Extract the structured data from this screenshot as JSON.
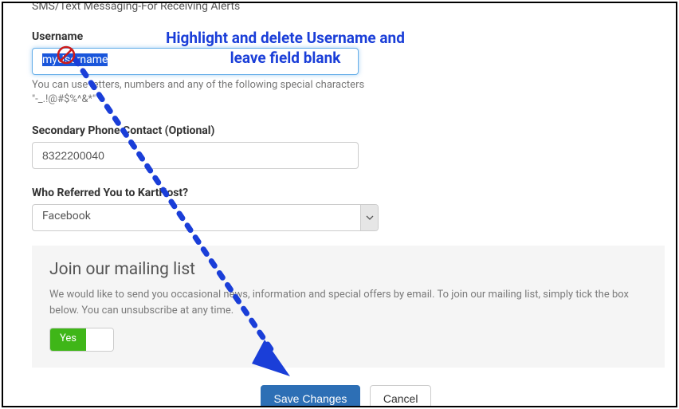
{
  "sections": {
    "sms_label": "SMS/Text Messaging-For Receiving Alerts"
  },
  "username": {
    "label": "Username",
    "value": "myUsername",
    "hint": "You can use letters, numbers and any of the following special characters \"-_.!@#$%^&*\""
  },
  "secondary_phone": {
    "label": "Secondary Phone Contact (Optional)",
    "value": "8322200040"
  },
  "referral": {
    "label": "Who Referred You to KartHost?",
    "value": "Facebook"
  },
  "mailing": {
    "heading": "Join our mailing list",
    "body": "We would like to send you occasional news, information and special offers by email. To join our mailing list, simply tick the box below. You can unsubscribe at any time.",
    "toggle_yes": "Yes"
  },
  "buttons": {
    "save": "Save Changes",
    "cancel": "Cancel"
  },
  "annotation": {
    "line1": "Highlight and delete Username and",
    "line2": "leave field blank"
  }
}
